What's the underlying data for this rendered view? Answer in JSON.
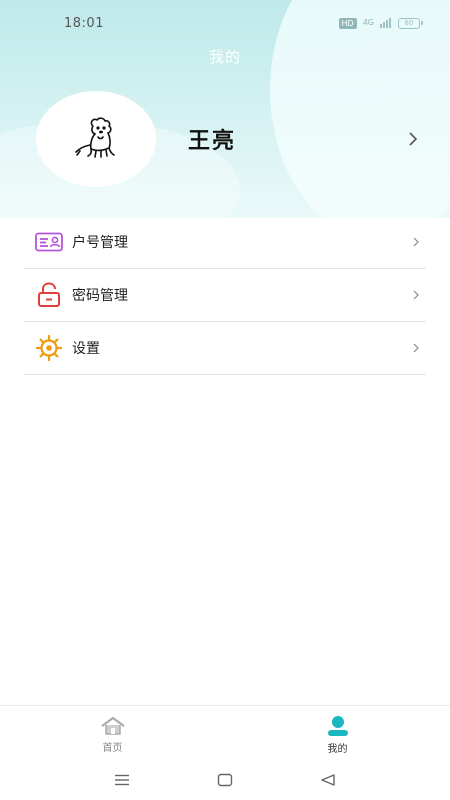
{
  "status_bar": {
    "time": "18:01",
    "hd_badge": "HD",
    "signal_text": "4G",
    "battery": "80"
  },
  "page": {
    "title": "我的"
  },
  "profile": {
    "name": "王亮",
    "avatar_icon": "dog-sketch-avatar"
  },
  "menu": {
    "items": [
      {
        "label": "户号管理",
        "icon": "id-card-icon",
        "color": "#b455d8"
      },
      {
        "label": "密码管理",
        "icon": "unlock-icon",
        "color": "#e0403a"
      },
      {
        "label": "设置",
        "icon": "gear-icon",
        "color": "#f19b12"
      }
    ]
  },
  "tabbar": {
    "tabs": [
      {
        "label": "首页",
        "icon": "home-icon",
        "active": false
      },
      {
        "label": "我的",
        "icon": "user-icon",
        "active": true
      }
    ],
    "active_color": "#1ab7c0",
    "inactive_color": "#aaaaaa"
  },
  "system_nav": {
    "buttons": [
      "menu-icon",
      "home-square-icon",
      "back-triangle-icon"
    ]
  }
}
